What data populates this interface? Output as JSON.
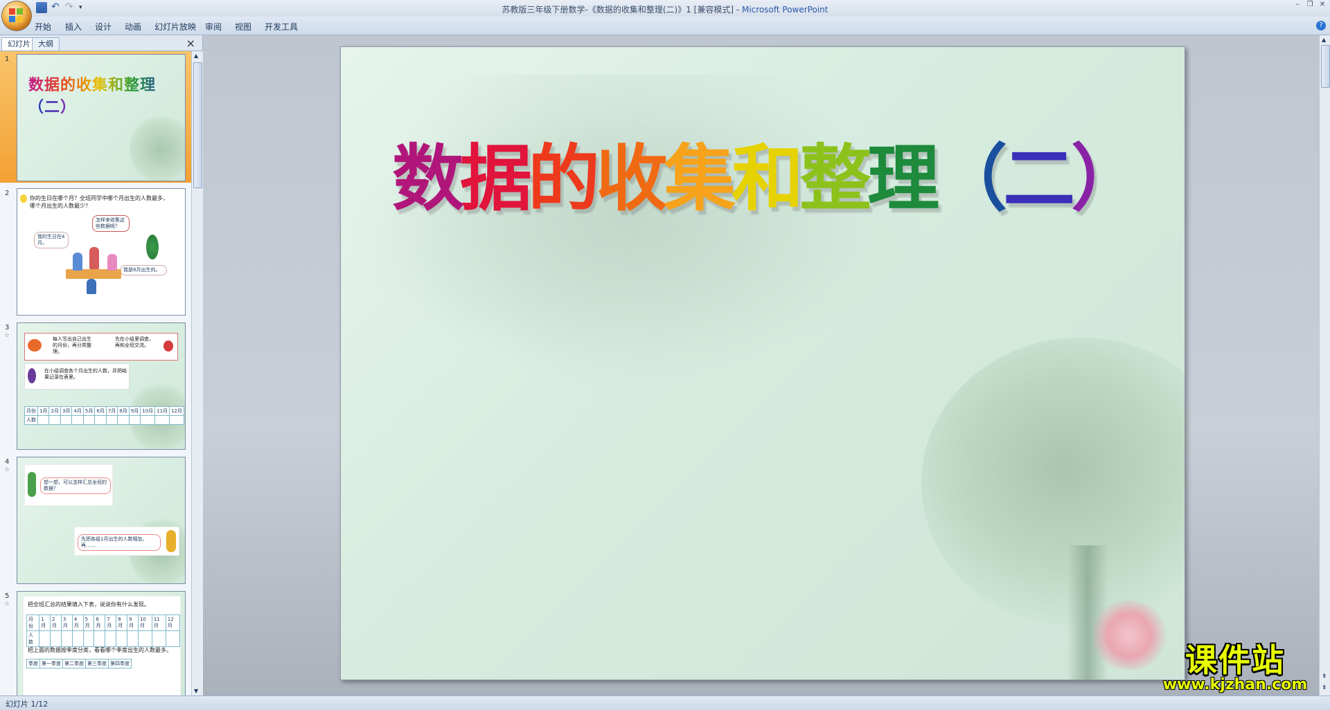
{
  "titlebar": {
    "title": "苏教版三年级下册数学-《数据的收集和整理(二)》1 [兼容模式] - ",
    "app": "Microsoft PowerPoint"
  },
  "ribbon": {
    "tabs": [
      "开始",
      "插入",
      "设计",
      "动画",
      "幻灯片放映",
      "审阅",
      "视图",
      "开发工具"
    ]
  },
  "leftpane": {
    "tabs": [
      "幻灯片",
      "大纲"
    ],
    "thumbnails": [
      {
        "num": "1",
        "title": "数据的收集和整理（二）"
      },
      {
        "num": "2",
        "line1": "你的生日在哪个月？全班同学中哪个月出生的人数最多，",
        "line2": "哪个月出生的人数最少？",
        "bubble1": "怎样来收集这些数据呢？",
        "bubble2": "我的生日在4月。",
        "bubble3": "我是8月出生的。"
      },
      {
        "num": "3",
        "text1": "每人写出自己出生的月份，再分类整理。",
        "text2": "先在小组里调查，再和全班交流。",
        "text3": "在小组调查各个月出生的人数，并把结果记录在表里。",
        "row1": [
          "月份",
          "1月",
          "2月",
          "3月",
          "4月",
          "5月",
          "6月",
          "7月",
          "8月",
          "9月",
          "10月",
          "11月",
          "12月"
        ],
        "row2": [
          "人数"
        ]
      },
      {
        "num": "4",
        "text1": "想一想，可以怎样汇总全班的数据？",
        "text2": "先把各组1月出生的人数相加，再……"
      },
      {
        "num": "5",
        "text1": "把全班汇总的结果填入下表，说说你有什么发现。",
        "row1": [
          "月份",
          "1月",
          "2月",
          "3月",
          "4月",
          "5月",
          "6月",
          "7月",
          "8月",
          "9月",
          "10月",
          "11月",
          "12月"
        ],
        "row2": [
          "人数"
        ],
        "text2": "把上面的数据按季度分类，看看哪个季度出生的人数最多。",
        "row3": [
          "季度",
          "第一季度",
          "第二季度",
          "第三季度",
          "第四季度"
        ]
      }
    ]
  },
  "slide": {
    "title_chars": [
      "数",
      "据",
      "的",
      "收",
      "集",
      "和",
      "整",
      "理",
      "（",
      "二",
      "）"
    ],
    "title_colors": [
      "#b0167a",
      "#e1143c",
      "#ee3a1c",
      "#f06a13",
      "#f6a21a",
      "#e6d200",
      "#8cc21b",
      "#1d8a3c",
      "#1a4f9e",
      "#3a2fb8",
      "#8a22a6"
    ]
  },
  "statusbar": {
    "slide_info": "幻灯片 1/12"
  },
  "watermark": {
    "text": "课件站",
    "url": "www.kjzhan.com"
  }
}
